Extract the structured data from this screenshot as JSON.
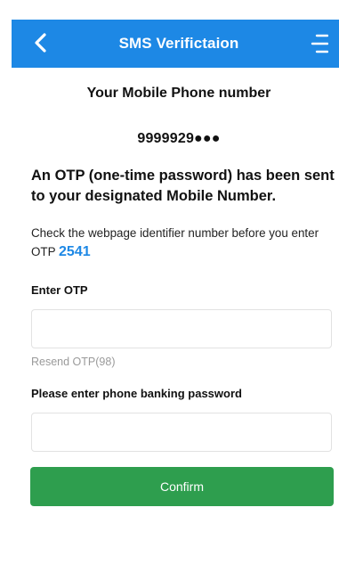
{
  "header": {
    "title": "SMS Verifictaion",
    "back_icon": "chevron-left-icon",
    "menu_icon": "menu-icon",
    "background_color": "#1d88e5"
  },
  "phone": {
    "section_title": "Your Mobile Phone number",
    "masked_number": "9999929●●●"
  },
  "otp_notice": "An OTP (one-time password) has been sent to your designated Mobile Number.",
  "instruction": {
    "text": "Check the webpage identifier number before you enter OTP",
    "identifier_code": "2541",
    "code_color": "#1d88e5"
  },
  "otp_field": {
    "label": "Enter OTP",
    "value": "",
    "placeholder": ""
  },
  "resend": {
    "label": "Resend OTP(98)"
  },
  "password_field": {
    "label": "Please enter phone banking password",
    "value": "",
    "placeholder": ""
  },
  "confirm_button": {
    "label": "Confirm",
    "color": "#2e9e4e"
  }
}
